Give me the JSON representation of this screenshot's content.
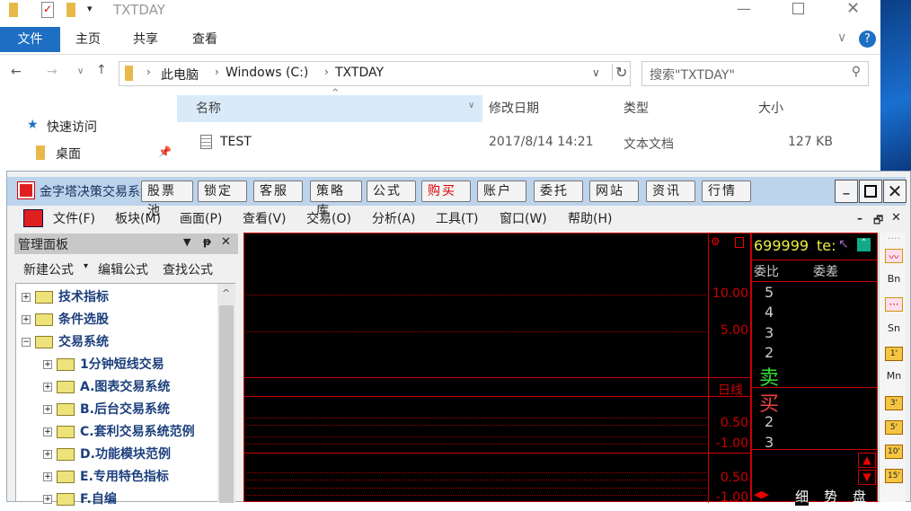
{
  "explorer": {
    "title": "TXTDAY",
    "ribbon_tabs": [
      "文件",
      "主页",
      "共享",
      "查看"
    ],
    "path": [
      "此电脑",
      "Windows (C:)",
      "TXTDAY"
    ],
    "search_placeholder": "搜索\"TXTDAY\"",
    "columns": [
      "名称",
      "修改日期",
      "类型",
      "大小"
    ],
    "files": [
      {
        "name": "TEST",
        "date": "2017/8/14 14:21",
        "type": "文本文档",
        "size": "127 KB"
      }
    ],
    "nav": [
      "快速访问",
      "桌面"
    ]
  },
  "app": {
    "title": "金字塔决策交易系统",
    "toolbar": [
      "股票池",
      "锁定",
      "客服",
      "策略库",
      "公式",
      "购买",
      "账户",
      "委托",
      "网站",
      "资讯",
      "行情"
    ],
    "menu": [
      "文件(F)",
      "板块(M)",
      "画面(P)",
      "查看(V)",
      "交易(O)",
      "分析(A)",
      "工具(T)",
      "窗口(W)",
      "帮助(H)"
    ],
    "panel": {
      "title": "管理面板",
      "actions": [
        "新建公式",
        "编辑公式",
        "查找公式"
      ],
      "tree": [
        {
          "label": "技术指标",
          "level": 0,
          "exp": "+"
        },
        {
          "label": "条件选股",
          "level": 0,
          "exp": "+"
        },
        {
          "label": "交易系统",
          "level": 0,
          "exp": "−"
        },
        {
          "label": "1分钟短线交易",
          "level": 1,
          "exp": "+"
        },
        {
          "label": "A.图表交易系统",
          "level": 1,
          "exp": "+"
        },
        {
          "label": "B.后台交易系统",
          "level": 1,
          "exp": "+"
        },
        {
          "label": "C.套利交易系统范例",
          "level": 1,
          "exp": "+"
        },
        {
          "label": "D.功能模块范例",
          "level": 1,
          "exp": "+"
        },
        {
          "label": "E.专用特色指标",
          "level": 1,
          "exp": "+"
        },
        {
          "label": "F.自编",
          "level": 1,
          "exp": "+"
        }
      ]
    },
    "chart": {
      "axis_main": [
        "10.00",
        "5.00"
      ],
      "period": "日线",
      "axis_sub1": [
        "0.50",
        "-1.00"
      ],
      "axis_sub2": [
        "0.50",
        "-1.00"
      ]
    },
    "quote": {
      "code": "699999",
      "name": "te:",
      "h1": "委比",
      "h2": "委差",
      "sell_levels": [
        "5",
        "4",
        "3",
        "2"
      ],
      "sell": "卖",
      "buy": "买",
      "buy_levels": [
        "2",
        "3"
      ],
      "tabs": [
        "细",
        "势",
        "盘"
      ]
    },
    "right_tools": [
      "Bn",
      "Sn",
      "1'",
      "Mn",
      "3'",
      "5'",
      "10'",
      "15'"
    ]
  }
}
